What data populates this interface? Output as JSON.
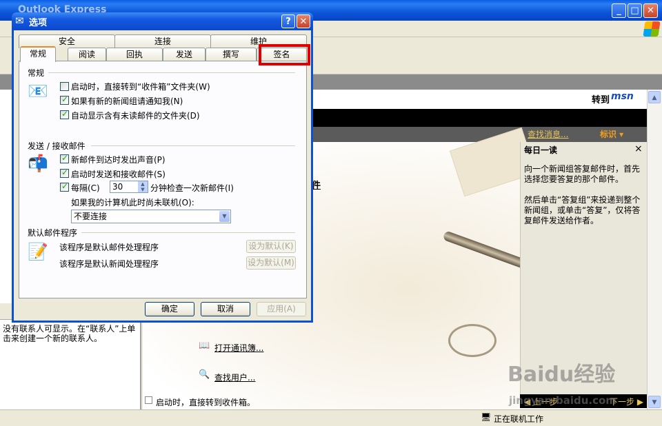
{
  "app": {
    "title": "Outlook Express",
    "minimize_glyph": "_",
    "maximize_glyph": "□",
    "close_glyph": "✕"
  },
  "msn": {
    "goto_label": "转到",
    "logo": "msn"
  },
  "info_bar": {
    "find_messages": "查找消息...",
    "mark_label": "标识 ▾"
  },
  "news_fragment": "件",
  "tip": {
    "title": "每日一读",
    "close": "×",
    "paragraph1": "向一个新闻组答复邮件时，首先选择您要答复的那个邮件。",
    "paragraph2": "然后单击“答复组”来投递到整个新闻组，或单击“答复”，仅将答复邮件发送给作者。",
    "prev": "◀ 上一步",
    "next": "下一步 ▶"
  },
  "contacts_text": "没有联系人可显示。在“联系人”上单击来创建一个新的联系人。",
  "links": {
    "open_address_book": "打开通讯簿...",
    "find_user": "查找用户..."
  },
  "bottom_checkbox": "启动时，直接转到收件箱。",
  "status": {
    "text": "正在联机工作"
  },
  "watermark": {
    "logo": "Baidu经验",
    "url": "jingyan.baidu.com"
  },
  "dialog": {
    "title": "选项",
    "help": "?",
    "close": "✕",
    "tabs_back": [
      "安全",
      "连接",
      "维护"
    ],
    "tabs_front": [
      "常规",
      "阅读",
      "回执",
      "发送",
      "撰写",
      "签名"
    ],
    "sections": {
      "general": "常规",
      "send_receive": "发送 / 接收邮件",
      "default_programs": "默认邮件程序"
    },
    "general_options": [
      {
        "label": "启动时，直接转到“收件箱”文件夹(W)",
        "checked": false
      },
      {
        "label": "如果有新的新闻组请通知我(N)",
        "checked": true
      },
      {
        "label": "自动显示含有未读邮件的文件夹(D)",
        "checked": true
      }
    ],
    "send_options": [
      {
        "label": "新邮件到达时发出声音(P)",
        "checked": true
      },
      {
        "label": "启动时发送和接收邮件(S)",
        "checked": true
      }
    ],
    "check_every": {
      "label": "每隔(C)",
      "checked": true,
      "value": "30",
      "suffix": "分钟检查一次新邮件(I)"
    },
    "offline_label": "如果我的计算机此时尚未联机(O):",
    "offline_select": "不要连接",
    "default_mail": {
      "label": "该程序是默认邮件处理程序",
      "button": "设为默认(K)"
    },
    "default_news": {
      "label": "该程序是默认新闻处理程序",
      "button": "设为默认(M)"
    },
    "buttons": {
      "ok": "确定",
      "cancel": "取消",
      "apply": "应用(A)"
    }
  },
  "colors": {
    "xp_blue": "#0b51d6",
    "highlight_red": "#e00000",
    "face": "#ece9d8"
  }
}
